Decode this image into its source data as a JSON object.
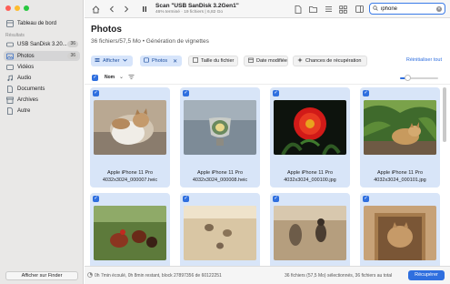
{
  "sidebar": {
    "dashboard": "Tableau de bord",
    "section_label": "Résultats",
    "device": {
      "name": "USB  SanDisk 3.20...",
      "count": "36"
    },
    "items": [
      {
        "label": "Photos",
        "count": "36",
        "icon": "photo-icon"
      },
      {
        "label": "Vidéos",
        "icon": "video-icon"
      },
      {
        "label": "Audio",
        "icon": "audio-icon"
      },
      {
        "label": "Documents",
        "icon": "document-icon"
      },
      {
        "label": "Archives",
        "icon": "archive-icon"
      },
      {
        "label": "Autre",
        "icon": "other-icon"
      }
    ],
    "finder_button": "Afficher sur Finder"
  },
  "toolbar": {
    "scan_title": "Scan \"USB  SanDisk 3.2Gen1\"",
    "scan_sub": "46% terminé · 19 fichiers | 6,82 Go",
    "search_value": "iphone"
  },
  "header": {
    "title": "Photos",
    "subtitle": "36 fichiers/57,5 Mo • Génération de vignettes"
  },
  "filters": {
    "show": "Afficher",
    "photos": "Photos",
    "size": "Taille du fichier",
    "date": "Date modifiée",
    "chances": "Chances de récupération",
    "reset": "Réinitialiser tout"
  },
  "list_header": {
    "name": "Nom",
    "zoom": 0.2
  },
  "photos": [
    {
      "title": "Apple iPhone 11 Pro",
      "file": "4032x3024_000007.heic"
    },
    {
      "title": "Apple iPhone 11 Pro",
      "file": "4032x3024_000008.heic"
    },
    {
      "title": "Apple iPhone 11 Pro",
      "file": "4032x3024_000100.jpg"
    },
    {
      "title": "Apple iPhone 11 Pro",
      "file": "4032x3024_000101.jpg"
    },
    {
      "title": "",
      "file": ""
    },
    {
      "title": "",
      "file": ""
    },
    {
      "title": "",
      "file": ""
    },
    {
      "title": "",
      "file": ""
    }
  ],
  "status": {
    "left": "0h 7min écoulé, 0h 8min restant, block 27897356 de 60122251",
    "right": "36 fichiers (57,5 Mo) sélectionnés, 36 fichiers au total",
    "recover": "Récupérer"
  },
  "colors": {
    "accent": "#2f6fdf",
    "card_bg": "#d8e5f8",
    "sidebar_bg": "#e9e8e7"
  }
}
